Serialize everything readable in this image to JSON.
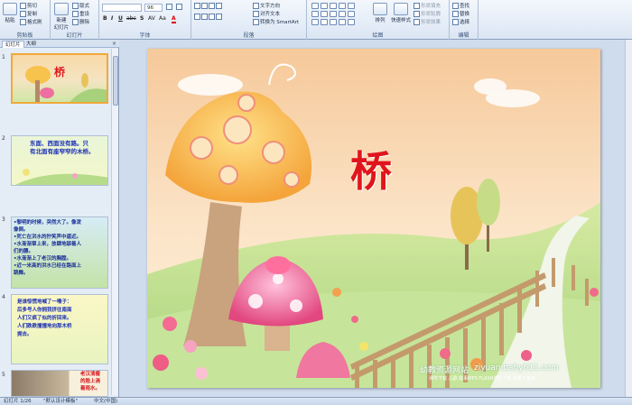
{
  "ribbon": {
    "clipboard": {
      "paste": "粘贴",
      "cut": "剪切",
      "copy": "复制",
      "format_painter": "格式刷",
      "label": "剪贴板"
    },
    "slides": {
      "new_slide": "新建\n幻灯片",
      "layout": "版式",
      "reset": "重设",
      "delete": "删除",
      "label": "幻灯片"
    },
    "font": {
      "font_size": "96",
      "label": "字体",
      "bold": "B",
      "italic": "I",
      "underline": "U",
      "strike": "abc",
      "shadow": "S",
      "spacing": "AV",
      "case": "Aa",
      "color": "A"
    },
    "paragraph": {
      "text_direction": "文字方向",
      "align_text": "对齐文本",
      "smartart": "转换为 SmartArt",
      "label": "段落"
    },
    "drawing": {
      "arrange": "排列",
      "quick_styles": "快速样式",
      "shape_fill": "形状填充",
      "shape_outline": "形状轮廓",
      "shape_effects": "形状效果",
      "label": "绘图"
    },
    "editing": {
      "find": "查找",
      "replace": "替换",
      "select": "选择",
      "label": "编辑"
    }
  },
  "panel": {
    "tab_slides": "幻灯片",
    "tab_outline": "大纲",
    "close": "×",
    "thumbs": [
      {
        "num": "1",
        "title": "桥"
      },
      {
        "num": "2",
        "lines": [
          "东面、西面没有路。只",
          "有北面有座窄窄的木桥。"
        ]
      },
      {
        "num": "3",
        "lines": [
          "•黎明的时候，突然大了。像泼",
          "  像倒。",
          "•死亡在洪水的狞笑声中逼近。",
          "•水渐渐窜上来，放肆地舔着人",
          "  们的腰。",
          "•水渐渐上了老汉的胸膛。",
          "•近一米高的洪水已经在路面上",
          "  跳舞。"
        ]
      },
      {
        "num": "4",
        "lines": [
          "是谁惊慌地喊了一嗓子：",
          "后多号人你拥我挤往南面",
          "人们又疯了似的折回来。",
          "人们跌跌撞撞地向那木桥",
          "拥去。"
        ]
      },
      {
        "num": "5",
        "lines": [
          "老汉清瘦",
          "的脸上淌",
          "着雨水。"
        ]
      }
    ]
  },
  "slide": {
    "title": "桥",
    "watermark_site": "幼教资源网站",
    "watermark_url": "ziyuan.baby611.com",
    "watermark_sub": "课件下载  儿歌  故事MP3  FLASH课件下载  试卷下载库"
  },
  "status": {
    "slide_index": "幻灯片 1/26",
    "theme": "\"默认设计模板\"",
    "language": "中文(中国)"
  },
  "colors": {
    "title_red": "#e0151c",
    "selected_thumb": "#f1a93a",
    "ribbon_bg": "#dbe6f4"
  }
}
